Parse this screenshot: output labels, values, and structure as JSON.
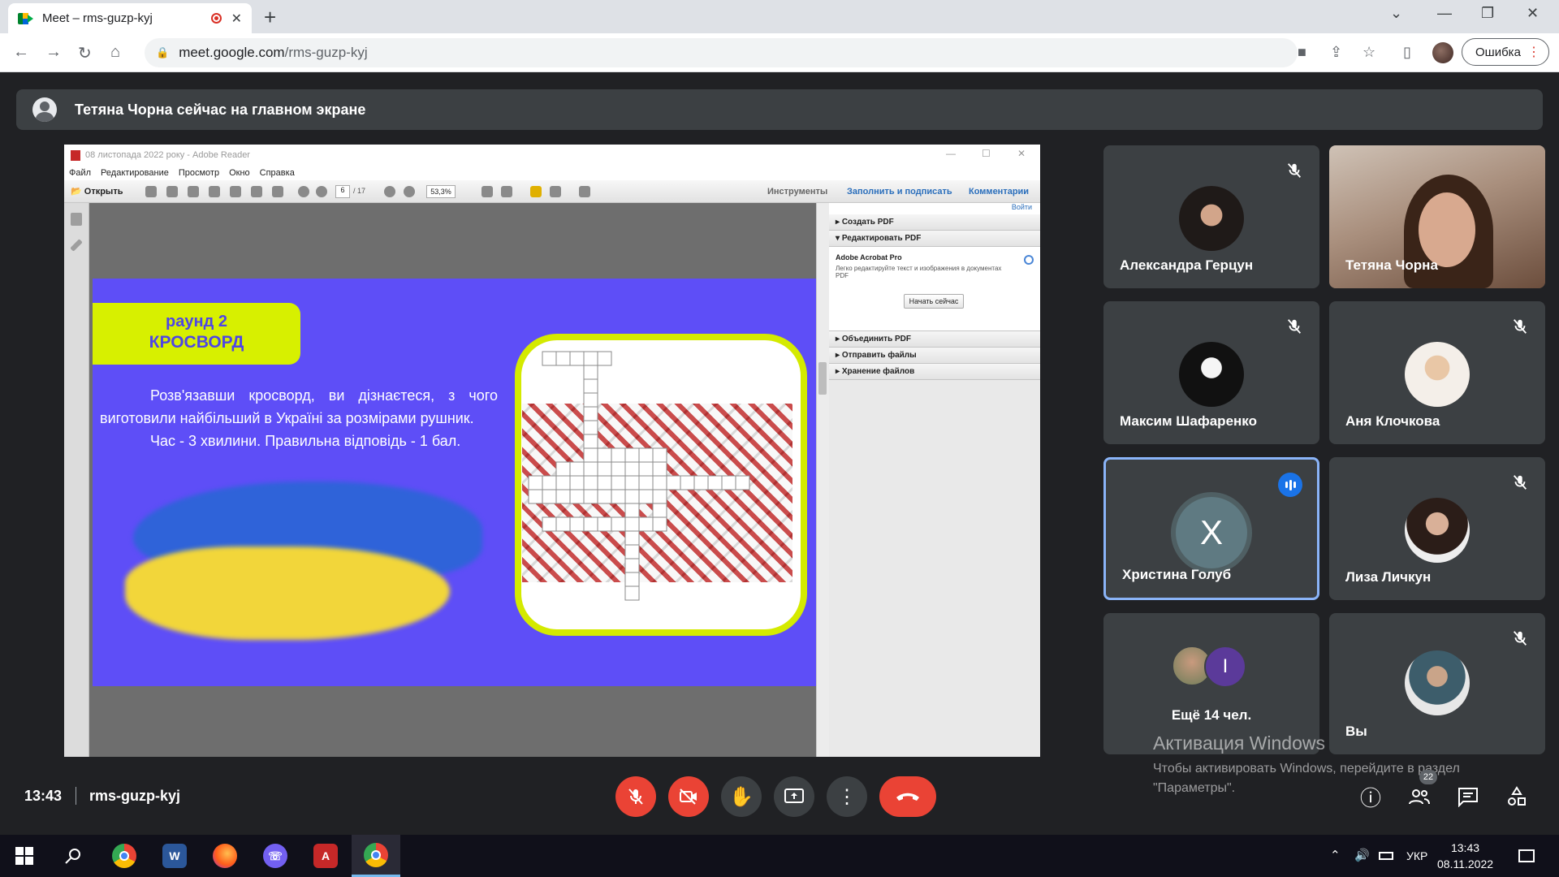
{
  "browser": {
    "tab_title": "Meet – rms-guzp-kyj",
    "new_tab": "+",
    "close_tab": "✕",
    "url_host": "meet.google.com",
    "url_path": "/rms-guzp-kyj",
    "error_button": "Ошибка",
    "colors": {
      "tabbar": "#dee1e6",
      "record": "#d93025"
    }
  },
  "meet": {
    "banner_text": "Тетяна Чорна сейчас на главном экране",
    "time": "13:43",
    "meeting_code": "rms-guzp-kyj",
    "participants_count": "22",
    "colors": {
      "background": "#202124",
      "tile": "#3c4043",
      "danger": "#ea4335",
      "active_border": "#8ab4f8",
      "speaking": "#1a73e8"
    }
  },
  "reader": {
    "title": "08 листопада 2022 року - Adobe Reader",
    "menu": [
      "Файл",
      "Редактирование",
      "Просмотр",
      "Окно",
      "Справка"
    ],
    "open_label": "Открыть",
    "page_current": "6",
    "page_total": "/ 17",
    "zoom": "53,3%",
    "tools_label": "Инструменты",
    "fill_sign_label": "Заполнить и подписать",
    "comments_label": "Комментарии",
    "login_label": "Войти",
    "create_pdf": "Создать PDF",
    "edit_pdf": "Редактировать PDF",
    "acrobat_title": "Adobe Acrobat Pro",
    "acrobat_desc": "Легко редактируйте текст и изображения в документах PDF",
    "start_now": "Начать сейчас",
    "combine_pdf": "Объединить PDF",
    "send_files": "Отправить файлы",
    "store_files": "Хранение файлов"
  },
  "slide": {
    "round_line1": "раунд 2",
    "round_line2": "КРОСВОРД",
    "paragraph1": "Розв'язавши кросворд, ви дізнаєтеся, з чого виготовили найбільший в Україні за розмірами рушник.",
    "paragraph2": "Час - 3 хвилини. Правильна відповідь - 1 бал.",
    "colors": {
      "background": "#5e4ef7",
      "accent": "#d7f000",
      "flag_blue": "#2f63d9",
      "flag_yellow": "#f2d63a"
    }
  },
  "tiles": [
    {
      "name": "Александра Герцун",
      "muted": true
    },
    {
      "name": "Тетяна Чорна",
      "muted": false
    },
    {
      "name": "Максим Шафаренко",
      "muted": true
    },
    {
      "name": "Аня Клочкова",
      "muted": true
    },
    {
      "name": "Христина Голуб",
      "muted": false,
      "initial": "Х",
      "speaking": true
    },
    {
      "name": "Лиза Личкун",
      "muted": true
    },
    {
      "more_text": "Ещё 14 чел.",
      "initial": "I"
    },
    {
      "name": "Вы",
      "muted": true
    }
  ],
  "activation": {
    "title": "Активация Windows",
    "line1": "Чтобы активировать Windows, перейдите в раздел",
    "line2": "\"Параметры\"."
  },
  "taskbar": {
    "lang": "УКР",
    "time": "13:43",
    "date": "08.11.2022",
    "apps": [
      "windows-start",
      "search",
      "chrome",
      "word",
      "firefox",
      "viber",
      "acrobat",
      "chrome"
    ]
  }
}
